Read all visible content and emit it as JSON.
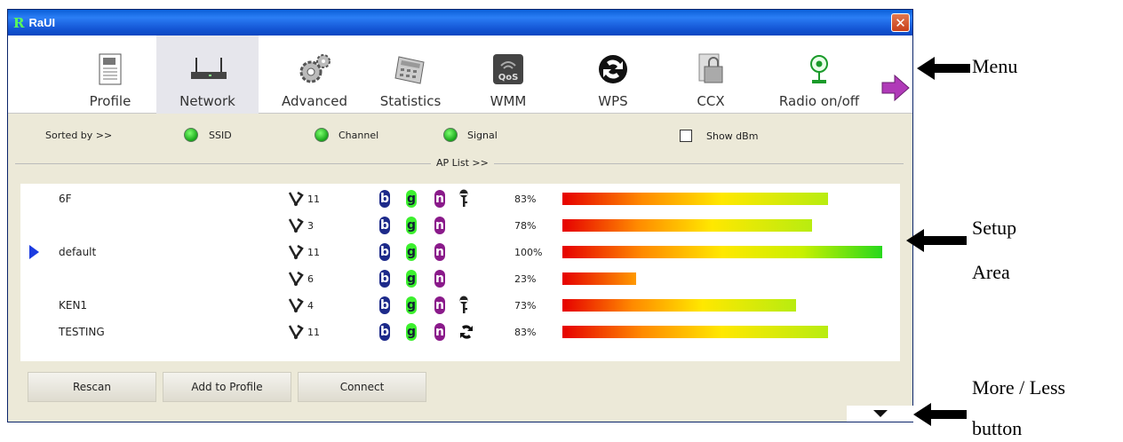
{
  "window": {
    "title": "RaUI",
    "logo": "R",
    "close_glyph": "✕"
  },
  "menu": {
    "items": [
      {
        "label": "Profile",
        "icon": "profile-icon"
      },
      {
        "label": "Network",
        "icon": "router-icon"
      },
      {
        "label": "Advanced",
        "icon": "gears-icon"
      },
      {
        "label": "Statistics",
        "icon": "calculator-icon"
      },
      {
        "label": "WMM",
        "icon": "qos-icon"
      },
      {
        "label": "WPS",
        "icon": "wps-icon"
      },
      {
        "label": "CCX",
        "icon": "ccx-icon"
      },
      {
        "label": "Radio on/off",
        "icon": "radio-icon"
      }
    ],
    "active": "Network"
  },
  "sortbar": {
    "sorted_by": "Sorted by >>",
    "ssid": "SSID",
    "channel": "Channel",
    "signal": "Signal",
    "show_dbm": "Show dBm",
    "ap_list": "AP List >>"
  },
  "ap_list": [
    {
      "ssid": "6F",
      "channel": "11",
      "security": "key",
      "signal_text": "83%",
      "signal": 83,
      "selected": false
    },
    {
      "ssid": "",
      "channel": "3",
      "security": "",
      "signal_text": "78%",
      "signal": 78,
      "selected": false
    },
    {
      "ssid": "default",
      "channel": "11",
      "security": "",
      "signal_text": "100%",
      "signal": 100,
      "selected": true
    },
    {
      "ssid": "",
      "channel": "6",
      "security": "",
      "signal_text": "23%",
      "signal": 23,
      "selected": false
    },
    {
      "ssid": "KEN1",
      "channel": "4",
      "security": "key",
      "signal_text": "73%",
      "signal": 73,
      "selected": false
    },
    {
      "ssid": "TESTING",
      "channel": "11",
      "security": "wps",
      "signal_text": "83%",
      "signal": 83,
      "selected": false
    }
  ],
  "modes": {
    "b": "b",
    "g": "g",
    "n": "n"
  },
  "buttons": {
    "rescan": "Rescan",
    "add_to_profile": "Add to Profile",
    "connect": "Connect"
  },
  "annotations": {
    "menu": "Menu",
    "setup_line1": "Setup",
    "setup_line2": "Area",
    "moreless_line1": "More / Less",
    "moreless_line2": "button"
  }
}
